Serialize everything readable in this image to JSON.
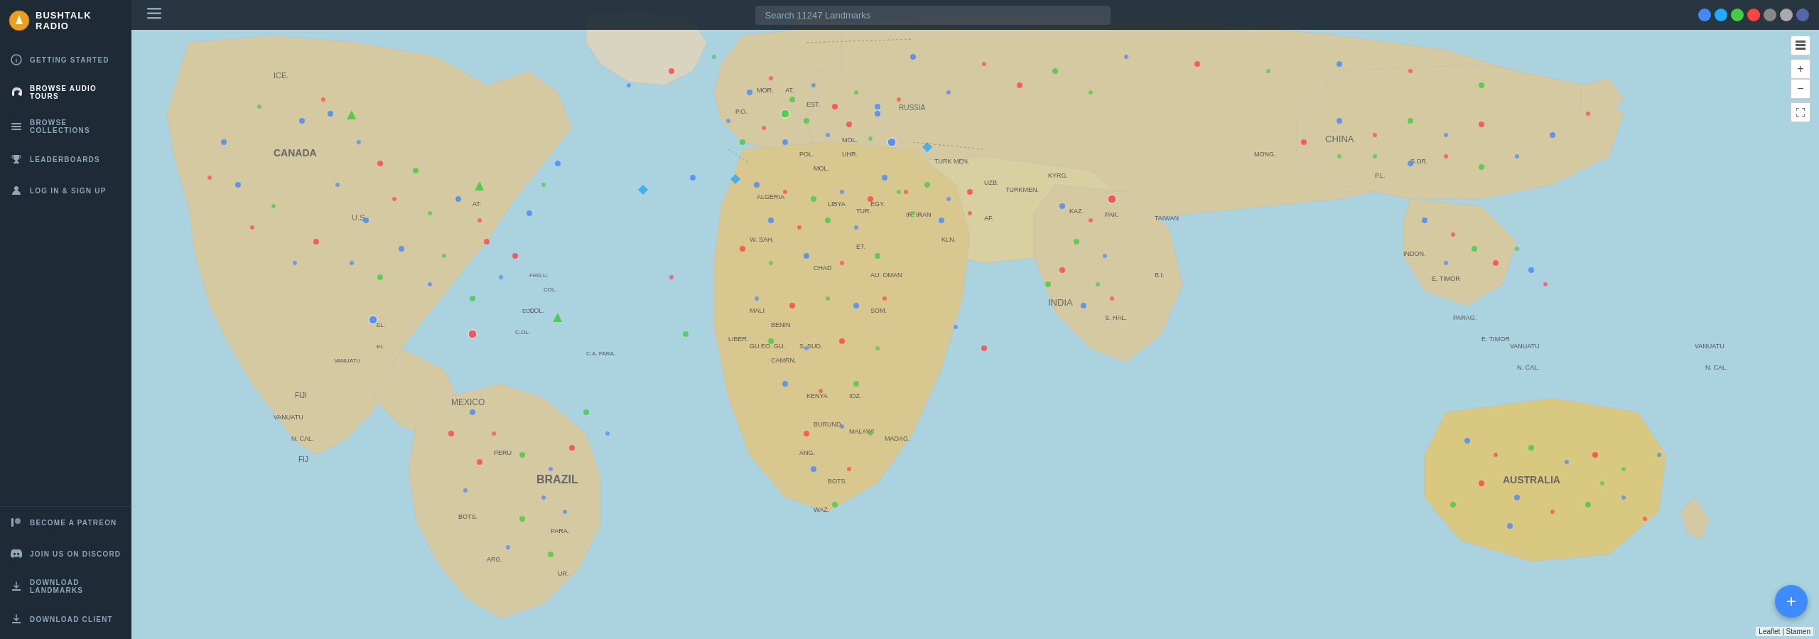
{
  "app": {
    "name": "BUSHTALK RADIO"
  },
  "header": {
    "search_placeholder": "Search 11247 Landmarks"
  },
  "sidebar": {
    "nav_items": [
      {
        "id": "getting-started",
        "label": "GETTING STARTED",
        "icon": "info-icon"
      },
      {
        "id": "browse-audio-tours",
        "label": "BROWSE AUDIO TOURS",
        "icon": "headphones-icon",
        "active": true
      },
      {
        "id": "browse-collections",
        "label": "BROWSE COLLECTIONS",
        "icon": "list-icon"
      },
      {
        "id": "leaderboards",
        "label": "LEADERBOARDS",
        "icon": "trophy-icon"
      },
      {
        "id": "log-in-sign-up",
        "label": "LOG IN & SIGN UP",
        "icon": "user-icon"
      }
    ],
    "bottom_items": [
      {
        "id": "become-patreon",
        "label": "BECOME A PATREON",
        "icon": "patreon-icon"
      },
      {
        "id": "join-discord",
        "label": "JOIN US ON DISCORD",
        "icon": "discord-icon"
      },
      {
        "id": "download-landmarks",
        "label": "DOWNLOAD LANDMARKS",
        "icon": "download-icon"
      },
      {
        "id": "download-client",
        "label": "DOWNLOAD CLIENT",
        "icon": "download-client-icon"
      }
    ]
  },
  "map_controls": {
    "zoom_in_label": "+",
    "zoom_out_label": "−",
    "fullscreen_label": "⤢"
  },
  "filter_dots": [
    {
      "color": "#4488ff",
      "id": "filter-blue"
    },
    {
      "color": "#22aaff",
      "id": "filter-lightblue"
    },
    {
      "color": "#44cc44",
      "id": "filter-green"
    },
    {
      "color": "#ff4444",
      "id": "filter-red"
    },
    {
      "color": "#888888",
      "id": "filter-gray1"
    },
    {
      "color": "#aaaaaa",
      "id": "filter-gray2"
    },
    {
      "color": "#5566aa",
      "id": "filter-darkblue"
    }
  ],
  "fab": {
    "label": "+"
  },
  "attribution": "Leaflet | Stamen"
}
